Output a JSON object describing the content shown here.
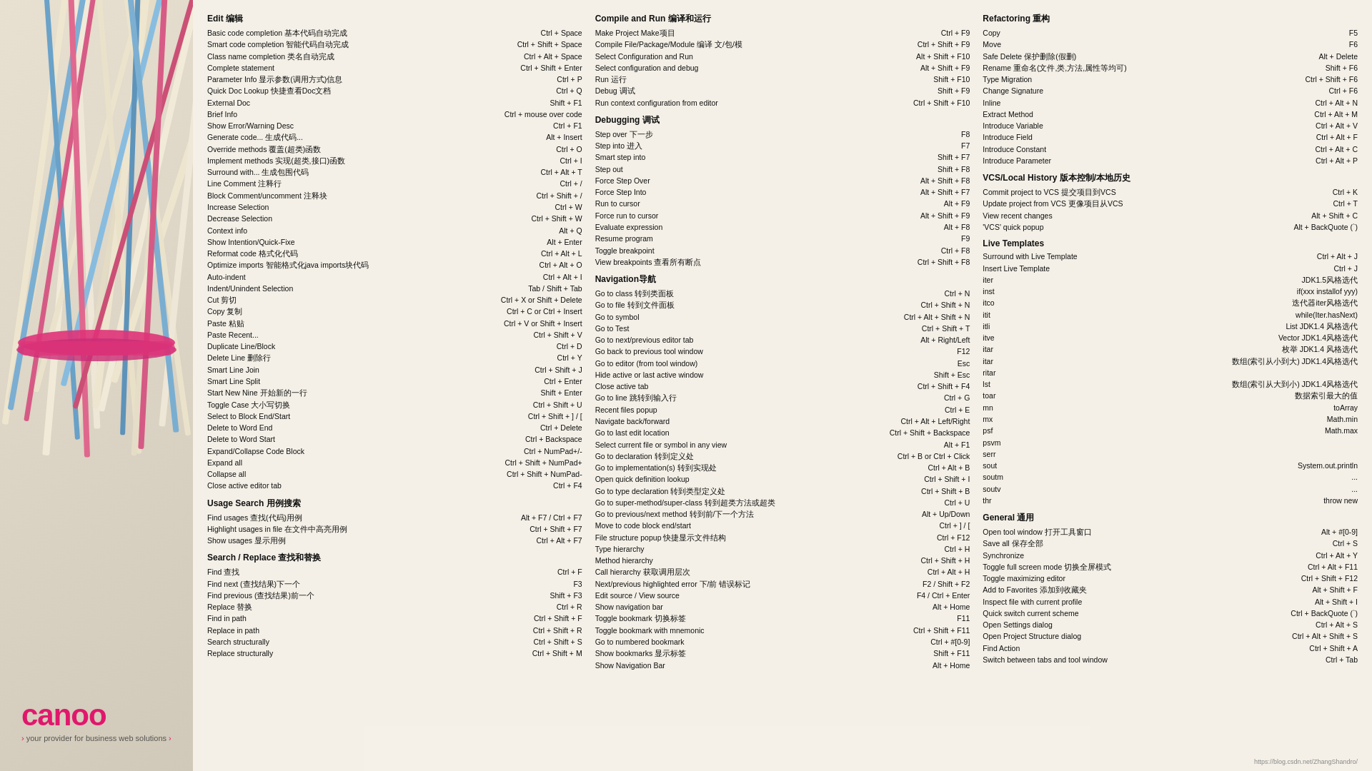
{
  "logo": {
    "text": "canoo",
    "tagline": "your provider for business web solutions",
    "arrow": "›",
    "url": "https://blog.csdn.net/ZhangShandro/"
  },
  "col1": {
    "sections": [
      {
        "title": "Edit 编辑",
        "rows": [
          {
            "label": "Basic code completion  基本代码自动完成",
            "key": "Ctrl + Space"
          },
          {
            "label": "Smart code completion  智能代码自动完成",
            "key": "Ctrl + Shift + Space"
          },
          {
            "label": "Class name completion  类名自动完成",
            "key": "Ctrl + Alt + Space"
          },
          {
            "label": "Complete statement",
            "key": "Ctrl + Shift + Enter"
          },
          {
            "label": "Parameter Info  显示参数(调用方式)信息",
            "key": "Ctrl + P"
          },
          {
            "label": "Quick Doc Lookup  快捷查看Doc文档",
            "key": "Ctrl + Q"
          },
          {
            "label": "External Doc",
            "key": "Shift + F1"
          },
          {
            "label": "Brief Info",
            "key": "Ctrl + mouse over code"
          },
          {
            "label": "Show Error/Warning Desc",
            "key": "Ctrl + F1"
          },
          {
            "label": "Generate code...  生成代码...",
            "key": "Alt + Insert"
          },
          {
            "label": "Override methods  覆盖(超类)函数",
            "key": "Ctrl + O"
          },
          {
            "label": "Implement methods  实现(超类,接口)函数",
            "key": "Ctrl + I"
          },
          {
            "label": "Surround with...  生成包围代码",
            "key": "Ctrl + Alt + T"
          },
          {
            "label": "Line Comment  注释行",
            "key": "Ctrl + /"
          },
          {
            "label": "Block Comment/uncomment  注释块",
            "key": "Ctrl + Shift + /"
          },
          {
            "label": "Increase Selection",
            "key": "Ctrl + W"
          },
          {
            "label": "Decrease Selection",
            "key": "Ctrl + Shift + W"
          },
          {
            "label": "Context info",
            "key": "Alt + Q"
          },
          {
            "label": "Show Intention/Quick-Fixe",
            "key": "Alt + Enter"
          },
          {
            "label": "Reformat code  格式化代码",
            "key": "Ctrl + Alt + L"
          },
          {
            "label": "Optimize imports  智能格式化java imports块代码",
            "key": "Ctrl + Alt + O"
          },
          {
            "label": "Auto-indent",
            "key": "Ctrl + Alt + I"
          },
          {
            "label": "Indent/Unindent Selection",
            "key": "Tab / Shift + Tab"
          },
          {
            "label": "Cut  剪切",
            "key": "Ctrl + X or Shift + Delete"
          },
          {
            "label": "Copy  复制",
            "key": "Ctrl + C or Ctrl + Insert"
          },
          {
            "label": "Paste  粘贴",
            "key": "Ctrl + V or Shift + Insert"
          },
          {
            "label": "Paste Recent...",
            "key": "Ctrl + Shift + V"
          },
          {
            "label": "Duplicate Line/Block",
            "key": "Ctrl + D"
          },
          {
            "label": "Delete Line  删除行",
            "key": "Ctrl + Y"
          },
          {
            "label": "Smart Line Join",
            "key": "Ctrl + Shift + J"
          },
          {
            "label": "Smart Line Split",
            "key": "Ctrl + Enter"
          },
          {
            "label": "Start New Nine  开始新的一行",
            "key": "Shift + Enter"
          },
          {
            "label": "Toggle Case  大小写切换",
            "key": "Ctrl + Shift + U"
          },
          {
            "label": "Select to Block End/Start",
            "key": "Ctrl + Shift + ] / ["
          },
          {
            "label": "Delete to Word End",
            "key": "Ctrl + Delete"
          },
          {
            "label": "Delete to Word Start",
            "key": "Ctrl + Backspace"
          },
          {
            "label": "Expand/Collapse Code Block",
            "key": "Ctrl + NumPad+/-"
          },
          {
            "label": "Expand all",
            "key": "Ctrl + Shift + NumPad+"
          },
          {
            "label": "Collapse all",
            "key": "Ctrl + Shift + NumPad-"
          },
          {
            "label": "Close active editor tab",
            "key": "Ctrl + F4"
          }
        ]
      },
      {
        "title": "Usage Search 用例搜索",
        "rows": [
          {
            "label": "Find usages  查找(代码)用例",
            "key": "Alt + F7 / Ctrl + F7"
          },
          {
            "label": "Highlight usages in file  在文件中高亮用例",
            "key": "Ctrl + Shift + F7"
          },
          {
            "label": "Show usages  显示用例",
            "key": "Ctrl + Alt + F7"
          }
        ]
      },
      {
        "title": "Search / Replace 查找和替换",
        "rows": [
          {
            "label": "Find  查找",
            "key": "Ctrl + F"
          },
          {
            "label": "Find next  (查找结果)下一个",
            "key": "F3"
          },
          {
            "label": "Find previous  (查找结果)前一个",
            "key": "Shift + F3"
          },
          {
            "label": "Replace  替换",
            "key": "Ctrl + R"
          },
          {
            "label": "Find in path",
            "key": "Ctrl + Shift + F"
          },
          {
            "label": "Replace in path",
            "key": "Ctrl + Shift + R"
          },
          {
            "label": "Search structurally",
            "key": "Ctrl + Shift + S"
          },
          {
            "label": "Replace structurally",
            "key": "Ctrl + Shift + M"
          }
        ]
      }
    ]
  },
  "col2": {
    "sections": [
      {
        "title": "Compile and Run 编译和运行",
        "rows": [
          {
            "label": "Make Project  Make项目",
            "key": "Ctrl + F9"
          },
          {
            "label": "Compile File/Package/Module  编译 文/包/模",
            "key": "Ctrl + Shift + F9"
          },
          {
            "label": "Select Configuration and Run",
            "key": "Alt + Shift + F10"
          },
          {
            "label": "Select configuration and debug",
            "key": "Alt + Shift + F9"
          },
          {
            "label": "Run  运行",
            "key": "Shift + F10"
          },
          {
            "label": "Debug  调试",
            "key": "Shift + F9"
          },
          {
            "label": "Run context configuration from editor",
            "key": "Ctrl + Shift + F10"
          }
        ]
      },
      {
        "title": "Debugging 调试",
        "rows": [
          {
            "label": "Step over  下一步",
            "key": "F8"
          },
          {
            "label": "Step into  进入",
            "key": "F7"
          },
          {
            "label": "Smart step into",
            "key": "Shift + F7"
          },
          {
            "label": "Step out",
            "key": "Shift + F8"
          },
          {
            "label": "Force Step Over",
            "key": "Alt + Shift + F8"
          },
          {
            "label": "Force Step Into",
            "key": "Alt + Shift + F7"
          },
          {
            "label": "Run to cursor",
            "key": "Alt + F9"
          },
          {
            "label": "Force run to cursor",
            "key": "Alt + Shift + F9"
          },
          {
            "label": "Evaluate expression",
            "key": "Alt + F8"
          },
          {
            "label": "Resume program",
            "key": "F9"
          },
          {
            "label": "Toggle breakpoint",
            "key": "Ctrl + F8"
          },
          {
            "label": "View breakpoints  查看所有断点",
            "key": "Ctrl + Shift + F8"
          }
        ]
      },
      {
        "title": "Navigation导航",
        "rows": [
          {
            "label": "Go to class  转到类面板",
            "key": "Ctrl + N"
          },
          {
            "label": "Go to file  转到文件面板",
            "key": "Ctrl + Shift + N"
          },
          {
            "label": "Go to symbol",
            "key": "Ctrl + Alt + Shift + N"
          },
          {
            "label": "Go to Test",
            "key": "Ctrl + Shift + T"
          },
          {
            "label": "Go to next/previous editor tab",
            "key": "Alt + Right/Left"
          },
          {
            "label": "Go back to previous tool window",
            "key": "F12"
          },
          {
            "label": "Go to editor (from tool window)",
            "key": "Esc"
          },
          {
            "label": "Hide active or last active window",
            "key": "Shift + Esc"
          },
          {
            "label": "Close active tab",
            "key": "Ctrl + Shift + F4"
          },
          {
            "label": "Go to line  跳转到输入行",
            "key": "Ctrl + G"
          },
          {
            "label": "Recent files popup",
            "key": "Ctrl + E"
          },
          {
            "label": "Navigate back/forward",
            "key": "Ctrl + Alt + Left/Right"
          },
          {
            "label": "Go to last edit location",
            "key": "Ctrl + Shift + Backspace"
          },
          {
            "label": "Select current file or symbol in any view",
            "key": "Alt + F1"
          },
          {
            "label": "Go to declaration  转到定义处",
            "key": "Ctrl + B or Ctrl + Click"
          },
          {
            "label": "Go to implementation(s)  转到实现处",
            "key": "Ctrl + Alt + B"
          },
          {
            "label": "Open quick definition lookup",
            "key": "Ctrl + Shift + I"
          },
          {
            "label": "Go to type declaration  转到类型定义处",
            "key": "Ctrl + Shift + B"
          },
          {
            "label": "Go to super-method/super-class  转到超类方法或超类",
            "key": "Ctrl + U"
          },
          {
            "label": "Go to previous/next method  转到前/下一个方法",
            "key": "Alt + Up/Down"
          },
          {
            "label": "Move to code block end/start",
            "key": "Ctrl + ] / ["
          },
          {
            "label": "File structure popup  快捷显示文件结构",
            "key": "Ctrl + F12"
          },
          {
            "label": "Type hierarchy",
            "key": "Ctrl + H"
          },
          {
            "label": "Method hierarchy",
            "key": "Ctrl + Shift + H"
          },
          {
            "label": "Call hierarchy  获取调用层次",
            "key": "Ctrl + Alt + H"
          },
          {
            "label": "Next/previous highlighted error  下/前 错误标记",
            "key": "F2 / Shift + F2"
          },
          {
            "label": "Edit source / View source",
            "key": "F4 / Ctrl + Enter"
          },
          {
            "label": "Show navigation bar",
            "key": "Alt + Home"
          },
          {
            "label": "Toggle bookmark  切换标签",
            "key": "F11"
          },
          {
            "label": "Toggle bookmark with mnemonic",
            "key": "Ctrl + Shift + F11"
          },
          {
            "label": "Go to numbered bookmark",
            "key": "Ctrl + #[0-9]"
          },
          {
            "label": "Show bookmarks  显示标签",
            "key": "Shift + F11"
          },
          {
            "label": "Show Navigation Bar",
            "key": "Alt + Home"
          }
        ]
      }
    ]
  },
  "col3": {
    "sections": [
      {
        "title": "Refactoring 重构",
        "rows": [
          {
            "label": "Copy",
            "key": "F5"
          },
          {
            "label": "Move",
            "key": "F6"
          },
          {
            "label": "Safe Delete  保护删除(假删)",
            "key": "Alt + Delete"
          },
          {
            "label": "Rename  重命名(文件,类,方法,属性等均可)",
            "key": "Shift + F6"
          },
          {
            "label": "Type Migration",
            "key": "Ctrl + Shift + F6"
          },
          {
            "label": "Change Signature",
            "key": "Ctrl + F6"
          },
          {
            "label": "Inline",
            "key": "Ctrl + Alt + N"
          },
          {
            "label": "Extract Method",
            "key": "Ctrl + Alt + M"
          },
          {
            "label": "Introduce Variable",
            "key": "Ctrl + Alt + V"
          },
          {
            "label": "Introduce Field",
            "key": "Ctrl + Alt + F"
          },
          {
            "label": "Introduce Constant",
            "key": "Ctrl + Alt + C"
          },
          {
            "label": "Introduce Parameter",
            "key": "Ctrl + Alt + P"
          }
        ]
      },
      {
        "title": "VCS/Local History 版本控制/本地历史",
        "rows": [
          {
            "label": "Commit project to VCS  提交项目到VCS",
            "key": "Ctrl + K"
          },
          {
            "label": "Update project from VCS  更像项目从VCS",
            "key": "Ctrl + T"
          },
          {
            "label": "View recent changes",
            "key": "Alt + Shift + C"
          },
          {
            "label": "'VCS' quick popup",
            "key": "Alt + BackQuote (`)"
          }
        ]
      },
      {
        "title": "Live Templates",
        "rows": [
          {
            "label": "Surround with Live Template",
            "key": "Ctrl + Alt + J"
          },
          {
            "label": "Insert Live Template",
            "key": "Ctrl + J"
          },
          {
            "label": "iter",
            "key": "JDK1.5风格选代"
          },
          {
            "label": "inst",
            "key": "if(xxx installof yyy)"
          },
          {
            "label": "itco",
            "key": "迭代器iter风格选代"
          },
          {
            "label": "itit",
            "key": "while(Iter.hasNext)"
          },
          {
            "label": "itli",
            "key": "List JDK1.4 风格选代"
          },
          {
            "label": "itve",
            "key": "Vector JDK1.4风格选代"
          },
          {
            "label": "itar",
            "key": "枚举 JDK1.4 风格选代"
          },
          {
            "label": "itar",
            "key": "数组(索引从小到大) JDK1.4风格选代"
          },
          {
            "label": "ritar",
            "key": ""
          },
          {
            "label": "lst",
            "key": "数组(索引从大到小) JDK1.4风格选代"
          },
          {
            "label": "toar",
            "key": "数据索引最大的值"
          },
          {
            "label": "mn",
            "key": "toArray"
          },
          {
            "label": "mx",
            "key": "Math.min"
          },
          {
            "label": "psf",
            "key": "Math.max"
          },
          {
            "label": "psvm",
            "key": ""
          },
          {
            "label": "serr",
            "key": ""
          },
          {
            "label": "sout",
            "key": "System.out.println"
          },
          {
            "label": "soutm",
            "key": "..."
          },
          {
            "label": "soutv",
            "key": "..."
          },
          {
            "label": "thr",
            "key": "throw new"
          }
        ]
      },
      {
        "title": "General 通用",
        "rows": [
          {
            "label": "Open tool window  打开工具窗口",
            "key": "Alt + #[0-9]"
          },
          {
            "label": "Save all  保存全部",
            "key": "Ctrl + S"
          },
          {
            "label": "Synchronize",
            "key": "Ctrl + Alt + Y"
          },
          {
            "label": "Toggle full screen mode  切换全屏模式",
            "key": "Ctrl + Alt + F11"
          },
          {
            "label": "Toggle maximizing editor",
            "key": "Ctrl + Shift + F12"
          },
          {
            "label": "Add to Favorites  添加到收藏夹",
            "key": "Alt + Shift + F"
          },
          {
            "label": "Inspect file with current profile",
            "key": "Alt + Shift + I"
          },
          {
            "label": "Quick switch current scheme",
            "key": "Ctrl + BackQuote (`)"
          },
          {
            "label": "Open Settings dialog",
            "key": "Ctrl + Alt + S"
          },
          {
            "label": "Open Project Structure dialog",
            "key": "Ctrl + Alt + Shift + S"
          },
          {
            "label": "Find Action",
            "key": "Ctrl + Shift + A"
          },
          {
            "label": "Switch between tabs and tool window",
            "key": "Ctrl + Tab"
          }
        ]
      }
    ]
  }
}
